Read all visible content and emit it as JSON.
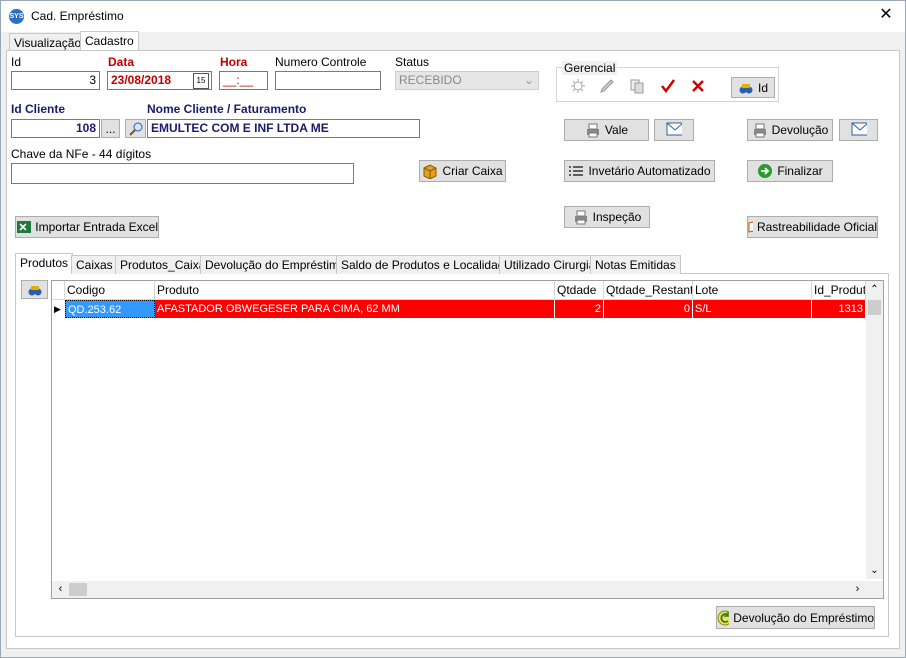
{
  "window": {
    "title": "Cad. Empréstimo",
    "icon_text": "SYS"
  },
  "tabs": [
    "Visualização",
    "Cadastro"
  ],
  "form": {
    "id_label": "Id",
    "id_value": "3",
    "data_label": "Data",
    "data_value": "23/08/2018",
    "hora_label": "Hora",
    "hora_value": "__:__",
    "numero_label": "Numero Controle",
    "numero_value": "",
    "status_label": "Status",
    "status_value": "RECEBIDO",
    "id_cliente_label": "Id Cliente",
    "id_cliente_value": "108",
    "nome_cliente_label": "Nome Cliente / Faturamento",
    "nome_cliente_value": "EMULTEC COM E INF LTDA ME",
    "chave_label": "Chave da NFe - 44 dígitos",
    "chave_value": "",
    "ellipsis": "..."
  },
  "gerencial": {
    "label": "Gerencial",
    "id_button": "Id"
  },
  "buttons": {
    "vale": "Vale",
    "devolucao": "Devolução",
    "criar_caixa": "Criar Caixa",
    "inventario": "Invetário Automatizado",
    "finalizar": "Finalizar",
    "importar": "Importar Entrada Excel",
    "inspecao": "Inspeção",
    "rastreabilidade": "Rastreabilidade Oficial",
    "devolucao_emprestimo": "Devolução do Empréstimo"
  },
  "subtabs": [
    "Produtos",
    "Caixas",
    "Produtos_Caixa",
    "Devolução do Empréstimo",
    "Saldo de Produtos e Localidade",
    "Utilizado Cirurgia",
    "Notas Emitidas"
  ],
  "grid": {
    "columns": [
      "Codigo",
      "Produto",
      "Qtdade",
      "Qtdade_Restante",
      "Lote",
      "Id_Produto"
    ],
    "rows": [
      {
        "codigo": "QD.253.62",
        "produto": "AFASTADOR OBWEGESER PARA CIMA, 62 MM",
        "qtdade": "2",
        "qtdade_restante": "0",
        "lote": "S/L",
        "id_produto": "1313"
      }
    ]
  },
  "colors": {
    "row_highlight": "#ff0000",
    "label_red": "#c00000",
    "label_blue": "#1a1a6e"
  }
}
